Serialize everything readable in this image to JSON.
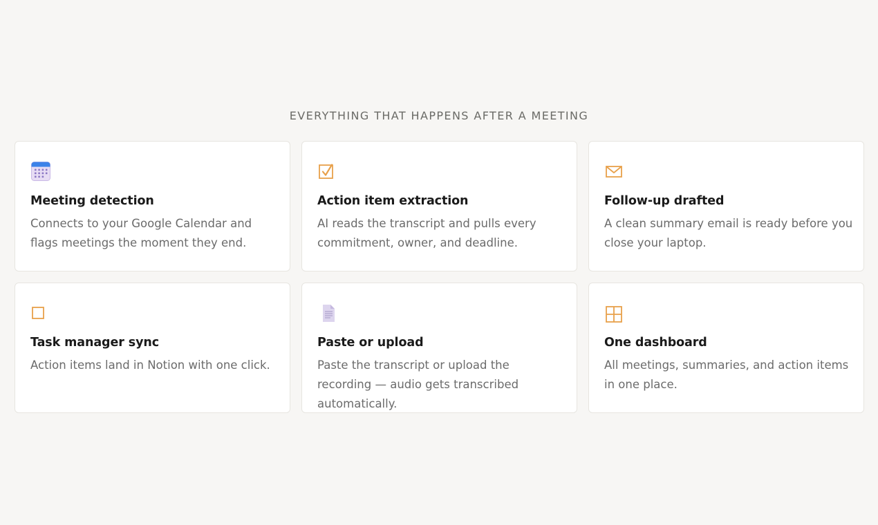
{
  "section": {
    "heading": "EVERYTHING THAT HAPPENS AFTER A MEETING"
  },
  "features": [
    {
      "icon": "calendar-icon",
      "title": "Meeting detection",
      "description": "Connects to your Google Calendar and flags meetings the moment they end."
    },
    {
      "icon": "checkbox-checked-icon",
      "title": "Action item extraction",
      "description": "AI reads the transcript and pulls every commitment, owner, and deadline."
    },
    {
      "icon": "envelope-icon",
      "title": "Follow-up drafted",
      "description": "A clean summary email is ready before you close your laptop."
    },
    {
      "icon": "checkbox-empty-icon",
      "title": "Task manager sync",
      "description": "Action items land in Notion with one click."
    },
    {
      "icon": "document-icon",
      "title": "Paste or upload",
      "description": "Paste the transcript or upload the recording — audio gets transcribed automatically."
    },
    {
      "icon": "dashboard-grid-icon",
      "title": "One dashboard",
      "description": "All meetings, summaries, and action items in one place."
    }
  ],
  "colors": {
    "accent": "#e8a04a",
    "background": "#f7f6f4",
    "card_background": "#ffffff",
    "card_border": "#e7e5e0",
    "calendar_blue": "#3b82e8",
    "calendar_body": "#e7dcf4",
    "document_lavender": "#ddd5ee"
  }
}
